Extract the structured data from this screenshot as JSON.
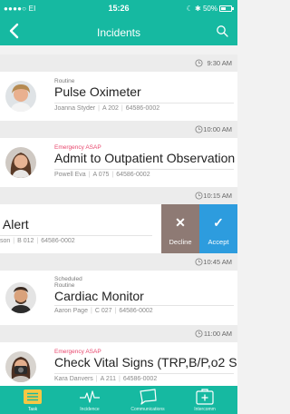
{
  "status_bar": {
    "carrier": "●●●●○ EI",
    "time": "15:26",
    "right": "☾ ✱ 50%",
    "battery_level": 0.5
  },
  "header": {
    "title": "Incidents"
  },
  "incidents": [
    {
      "time": "9:30 AM",
      "category": "Routine",
      "title": "Pulse Oximeter",
      "name": "Joanna Styder",
      "room": "A 202",
      "id": "64586-0002"
    },
    {
      "time": "10:00 AM",
      "category": "Emergency ASAP",
      "title": "Admit to Outpatient Observation",
      "name": "Powell Eva",
      "room": "A 075",
      "id": "64586-0002"
    },
    {
      "time": "10:15 AM",
      "title": "p Alert",
      "name": "son",
      "room": "B 012",
      "id": "64586-0002",
      "actions": {
        "decline": "Decline",
        "accept": "Accept"
      }
    },
    {
      "time": "10:45 AM",
      "category_top": "Scheduled",
      "category": "Routine",
      "title": "Cardiac Monitor",
      "name": "Aaron Page",
      "room": "C 027",
      "id": "64586-0002"
    },
    {
      "time": "11:00 AM",
      "category": "Emergency ASAP",
      "title": "Check Vital Signs (TRP,B/P,o2 Sat)",
      "name": "Kara Danvers",
      "room": "A 211",
      "id": "64586-0002"
    }
  ],
  "tabs": [
    {
      "label": "Task",
      "icon": "list-icon"
    },
    {
      "label": "Incidence",
      "icon": "pulse-icon"
    },
    {
      "label": "Communications",
      "icon": "chat-icon"
    },
    {
      "label": "Intercomm",
      "icon": "medical-icon"
    }
  ],
  "colors": {
    "primary": "#16b9a1",
    "asap": "#e8476d",
    "decline": "#8e7a74",
    "accept": "#2d9cde",
    "active_tab": "#f6c744"
  }
}
